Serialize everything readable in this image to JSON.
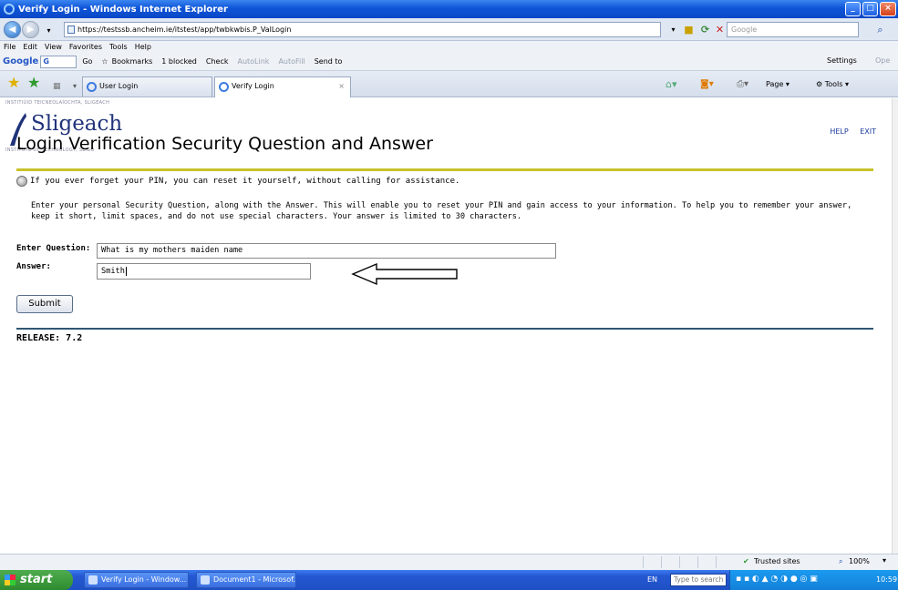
{
  "window": {
    "title": "Verify Login - Windows Internet Explorer"
  },
  "address": {
    "url": "https://testssb.ancheim.ie/itstest/app/twbkwbis.P_ValLogin",
    "search_placeholder": "Google"
  },
  "menu": [
    "File",
    "Edit",
    "View",
    "Favorites",
    "Tools",
    "Help"
  ],
  "google_toolbar": {
    "logo": "Google",
    "input": "G",
    "go": "Go",
    "bookmarks": "Bookmarks",
    "blocked": "1 blocked",
    "check": "Check",
    "autolink": "AutoLink",
    "autofill": "AutoFill",
    "send_to": "Send to",
    "settings": "Settings",
    "overflow": "Ope"
  },
  "tabs": [
    {
      "label": "User Login"
    },
    {
      "label": "Verify Login"
    }
  ],
  "command_bar": {
    "page": "Page",
    "tools": "Tools"
  },
  "logo": {
    "irish_line": "INSTITIÚID TEICNEOLAÍOCHTA, SLIGEACH",
    "name": "Sligeach",
    "english_line": "INSTITUTE OF TECHNOLOGY, SLIGO"
  },
  "links": {
    "help": "HELP",
    "exit": "EXIT"
  },
  "page": {
    "heading": "Login Verification Security Question and Answer",
    "tip": "If you ever forget your PIN, you can reset it yourself, without calling for assistance.",
    "instructions_line1": "Enter your personal Security Question, along with the Answer. This will enable you to reset your PIN and gain access to your information. To help you to remember your answer,",
    "instructions_line2": "keep it short, limit spaces, and do not use special characters. Your answer is limited to 30 characters.",
    "question_label": "Enter Question:",
    "question_value": "What is my mothers maiden name",
    "answer_label": "Answer:",
    "answer_value": "Smith",
    "submit_label": "Submit",
    "release": "RELEASE: 7.2"
  },
  "status": {
    "zone": "Trusted sites",
    "zoom": "100%"
  },
  "taskbar": {
    "start": "start",
    "tasks": [
      "Verify Login - Window...",
      "Document1 - Microsof..."
    ],
    "lang": "EN",
    "search_placeholder": "Type to search",
    "clock": "10:59"
  },
  "colors": {
    "accent_rule": "#c9c22a",
    "bottom_rule": "#2f5872",
    "link": "#1a3a9a",
    "logo": "#20337a"
  }
}
